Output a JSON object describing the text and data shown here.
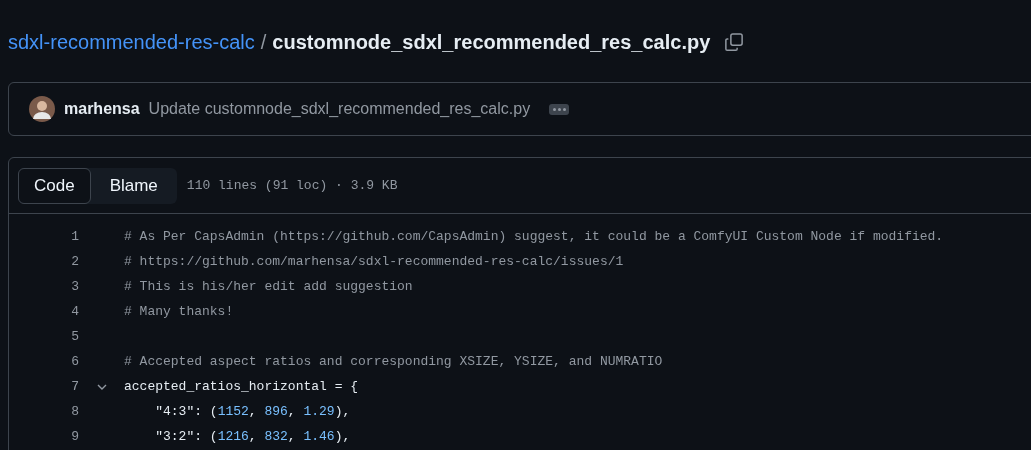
{
  "breadcrumb": {
    "repo": "sdxl-recommended-res-calc",
    "separator": "/",
    "file": "customnode_sdxl_recommended_res_calc.py"
  },
  "commit": {
    "author": "marhensa",
    "message": "Update customnode_sdxl_recommended_res_calc.py"
  },
  "tabs": [
    {
      "label": "Code",
      "selected": true
    },
    {
      "label": "Blame",
      "selected": false
    }
  ],
  "file_info": "110 lines (91 loc) · 3.9 KB",
  "lines": [
    {
      "number": "1",
      "tokens": [
        {
          "kind": "comment",
          "text": "# As Per CapsAdmin (https://github.com/CapsAdmin) suggest, it could be a ComfyUI Custom Node if modified."
        }
      ]
    },
    {
      "number": "2",
      "tokens": [
        {
          "kind": "comment",
          "text": "# https://github.com/marhensa/sdxl-recommended-res-calc/issues/1"
        }
      ]
    },
    {
      "number": "3",
      "tokens": [
        {
          "kind": "comment",
          "text": "# This is his/her edit add suggestion"
        }
      ]
    },
    {
      "number": "4",
      "tokens": [
        {
          "kind": "comment",
          "text": "# Many thanks!"
        }
      ]
    },
    {
      "number": "5"
    },
    {
      "number": "6",
      "tokens": [
        {
          "kind": "comment",
          "text": "# Accepted aspect ratios and corresponding XSIZE, YSIZE, and NUMRATIO"
        }
      ]
    },
    {
      "number": "7",
      "expanded": true,
      "tokens": [
        {
          "kind": "plain",
          "text": "accepted_ratios_horizontal = {"
        }
      ]
    },
    {
      "number": "8",
      "tokens": [
        {
          "kind": "plain",
          "text": "    \"4:3\": ("
        },
        {
          "kind": "number",
          "text": "1152"
        },
        {
          "kind": "plain",
          "text": ", "
        },
        {
          "kind": "number",
          "text": "896"
        },
        {
          "kind": "plain",
          "text": ", "
        },
        {
          "kind": "number",
          "text": "1.29"
        },
        {
          "kind": "plain",
          "text": "),"
        }
      ]
    },
    {
      "number": "9",
      "tokens": [
        {
          "kind": "plain",
          "text": "    \"3:2\": ("
        },
        {
          "kind": "number",
          "text": "1216"
        },
        {
          "kind": "plain",
          "text": ", "
        },
        {
          "kind": "number",
          "text": "832"
        },
        {
          "kind": "plain",
          "text": ", "
        },
        {
          "kind": "number",
          "text": "1.46"
        },
        {
          "kind": "plain",
          "text": "),"
        }
      ]
    }
  ]
}
